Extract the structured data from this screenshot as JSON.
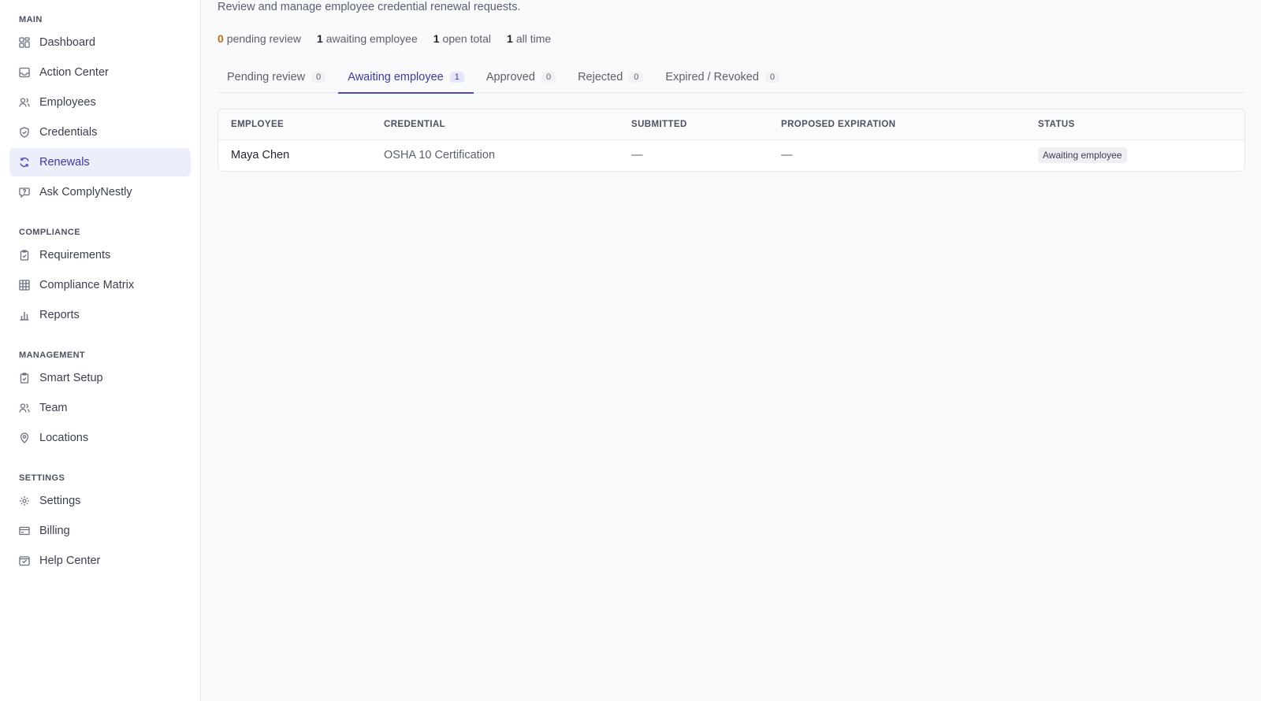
{
  "sidebar": {
    "sections": [
      {
        "label": "MAIN",
        "items": [
          {
            "label": "Dashboard",
            "icon": "grid-icon"
          },
          {
            "label": "Action Center",
            "icon": "inbox-icon"
          },
          {
            "label": "Employees",
            "icon": "users-icon"
          },
          {
            "label": "Credentials",
            "icon": "shield-icon"
          },
          {
            "label": "Renewals",
            "icon": "refresh-icon",
            "active": true
          },
          {
            "label": "Ask ComplyNestly",
            "icon": "chat-icon"
          }
        ]
      },
      {
        "label": "COMPLIANCE",
        "items": [
          {
            "label": "Requirements",
            "icon": "clipboard-check-icon"
          },
          {
            "label": "Compliance Matrix",
            "icon": "table-icon"
          },
          {
            "label": "Reports",
            "icon": "bar-chart-icon"
          }
        ]
      },
      {
        "label": "MANAGEMENT",
        "items": [
          {
            "label": "Smart Setup",
            "icon": "clipboard-check-icon"
          },
          {
            "label": "Team",
            "icon": "users-icon"
          },
          {
            "label": "Locations",
            "icon": "map-pin-icon"
          }
        ]
      },
      {
        "label": "SETTINGS",
        "items": [
          {
            "label": "Settings",
            "icon": "gear-icon"
          },
          {
            "label": "Billing",
            "icon": "credit-card-icon"
          },
          {
            "label": "Help Center",
            "icon": "help-inbox-icon"
          }
        ]
      }
    ]
  },
  "main": {
    "subtitle": "Review and manage employee credential renewal requests.",
    "stats": [
      {
        "value": "0",
        "label": "pending review",
        "accent": "#c26a10"
      },
      {
        "value": "1",
        "label": "awaiting employee"
      },
      {
        "value": "1",
        "label": "open total"
      },
      {
        "value": "1",
        "label": "all time"
      }
    ],
    "tabs": [
      {
        "label": "Pending review",
        "count": "0"
      },
      {
        "label": "Awaiting employee",
        "count": "1",
        "active": true
      },
      {
        "label": "Approved",
        "count": "0"
      },
      {
        "label": "Rejected",
        "count": "0"
      },
      {
        "label": "Expired / Revoked",
        "count": "0"
      }
    ],
    "table": {
      "columns": [
        "EMPLOYEE",
        "CREDENTIAL",
        "SUBMITTED",
        "PROPOSED EXPIRATION",
        "STATUS"
      ],
      "rows": [
        {
          "employee": "Maya Chen",
          "credential": "OSHA 10 Certification",
          "submitted": "—",
          "proposed_expiration": "—",
          "status": "Awaiting employee"
        }
      ]
    }
  },
  "colors": {
    "accent": "#4c47c2",
    "active_bg": "#eceefb",
    "warn": "#c26a10"
  }
}
